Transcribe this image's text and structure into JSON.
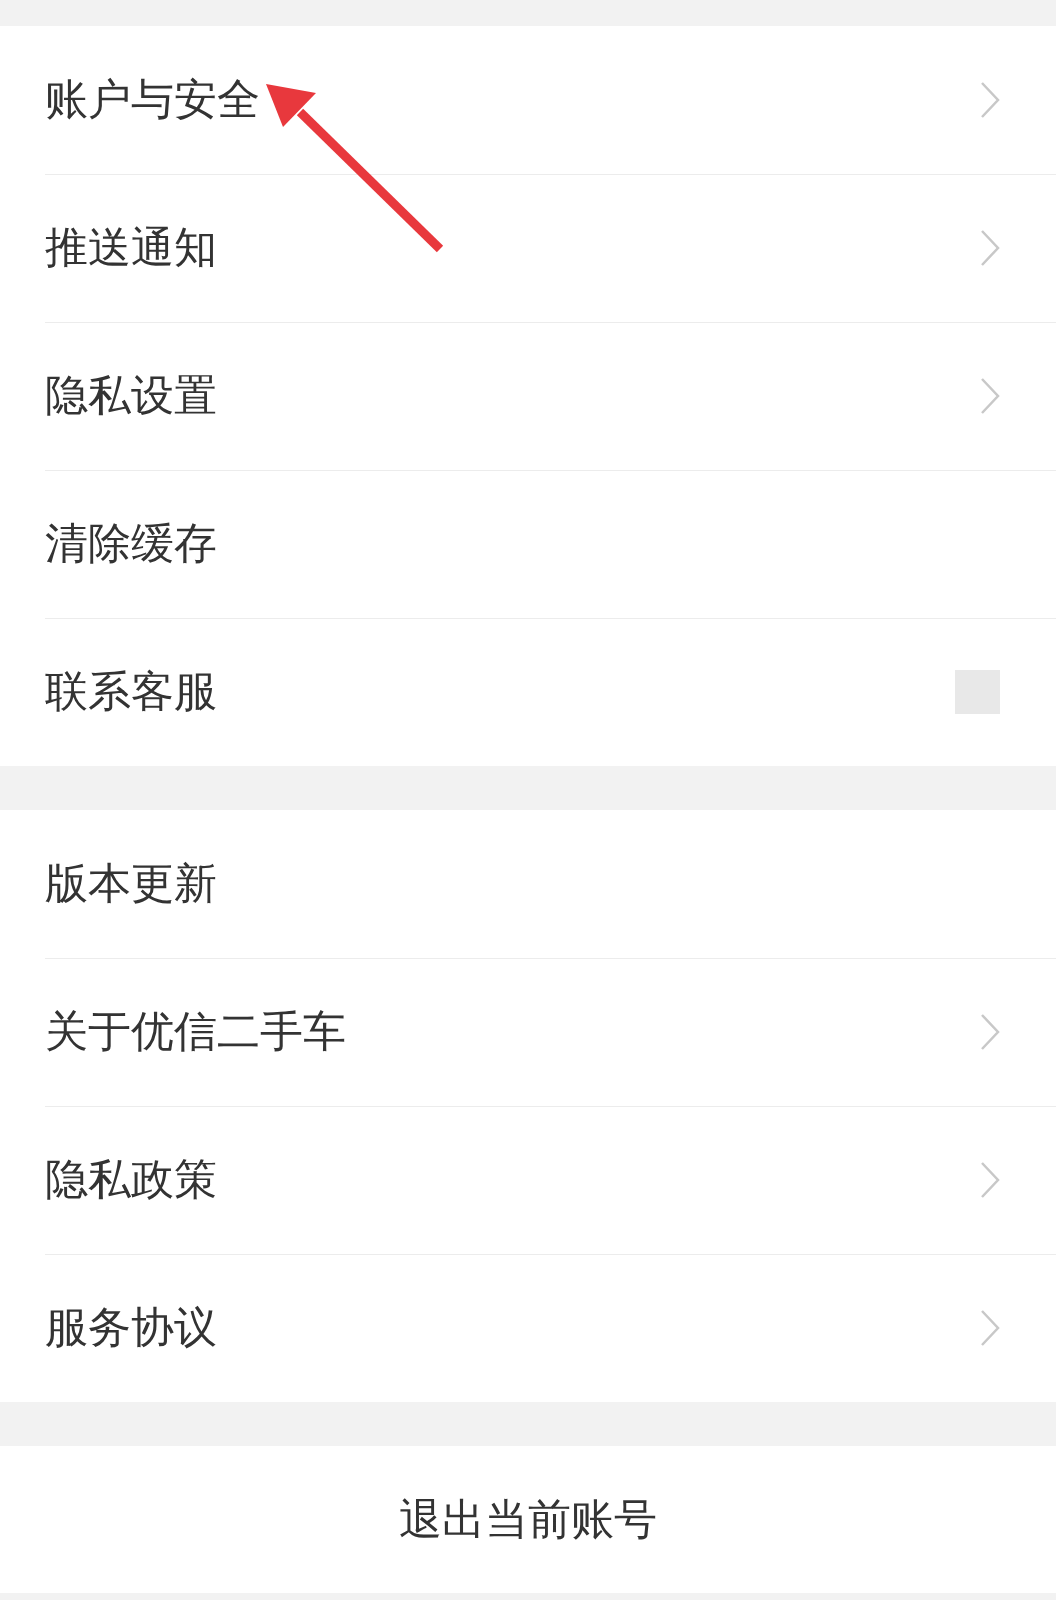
{
  "groups": [
    {
      "items": [
        {
          "label": "账户与安全",
          "chevron": true,
          "redacted": false
        },
        {
          "label": "推送通知",
          "chevron": true,
          "redacted": false
        },
        {
          "label": "隐私设置",
          "chevron": true,
          "redacted": false
        },
        {
          "label": "清除缓存",
          "chevron": false,
          "redacted": false
        },
        {
          "label": "联系客服",
          "chevron": false,
          "redacted": true
        }
      ]
    },
    {
      "items": [
        {
          "label": "版本更新",
          "chevron": false,
          "redacted": false
        },
        {
          "label": "关于优信二手车",
          "chevron": true,
          "redacted": false
        },
        {
          "label": "隐私政策",
          "chevron": true,
          "redacted": false
        },
        {
          "label": "服务协议",
          "chevron": true,
          "redacted": false
        }
      ]
    }
  ],
  "logout": {
    "label": "退出当前账号"
  },
  "annotations": [
    {
      "kind": "arrow"
    }
  ]
}
